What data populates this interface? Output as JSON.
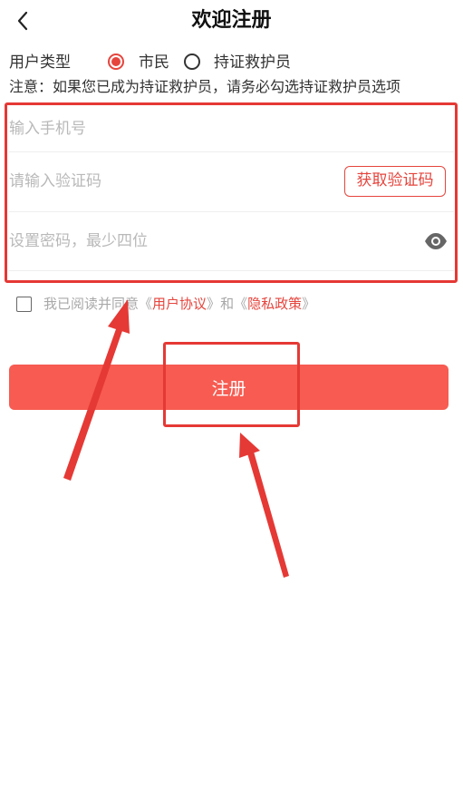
{
  "header": {
    "title": "欢迎注册",
    "back_icon": "chevron-left-icon"
  },
  "user_type": {
    "label": "用户类型",
    "options": [
      {
        "label": "市民",
        "selected": true
      },
      {
        "label": "持证救护员",
        "selected": false
      }
    ]
  },
  "notice": "注意：如果您已成为持证救护员，请务必勾选持证救护员选项",
  "form": {
    "phone_placeholder": "输入手机号",
    "code_placeholder": "请输入验证码",
    "get_code_label": "获取验证码",
    "password_placeholder": "设置密码，最少四位",
    "password_visibility_icon": "eye-icon"
  },
  "agreement": {
    "prefix": "我已阅读并同意",
    "open_quote_1": "《",
    "user_agreement": "用户协议",
    "close_quote_1": "》",
    "and": "和",
    "open_quote_2": "《",
    "privacy_policy": "隐私政策",
    "close_quote_2": "》",
    "checked": false
  },
  "register_button": {
    "label": "注册"
  },
  "colors": {
    "accent": "#e5453d",
    "button": "#f75b51",
    "annotation": "#e53935"
  }
}
